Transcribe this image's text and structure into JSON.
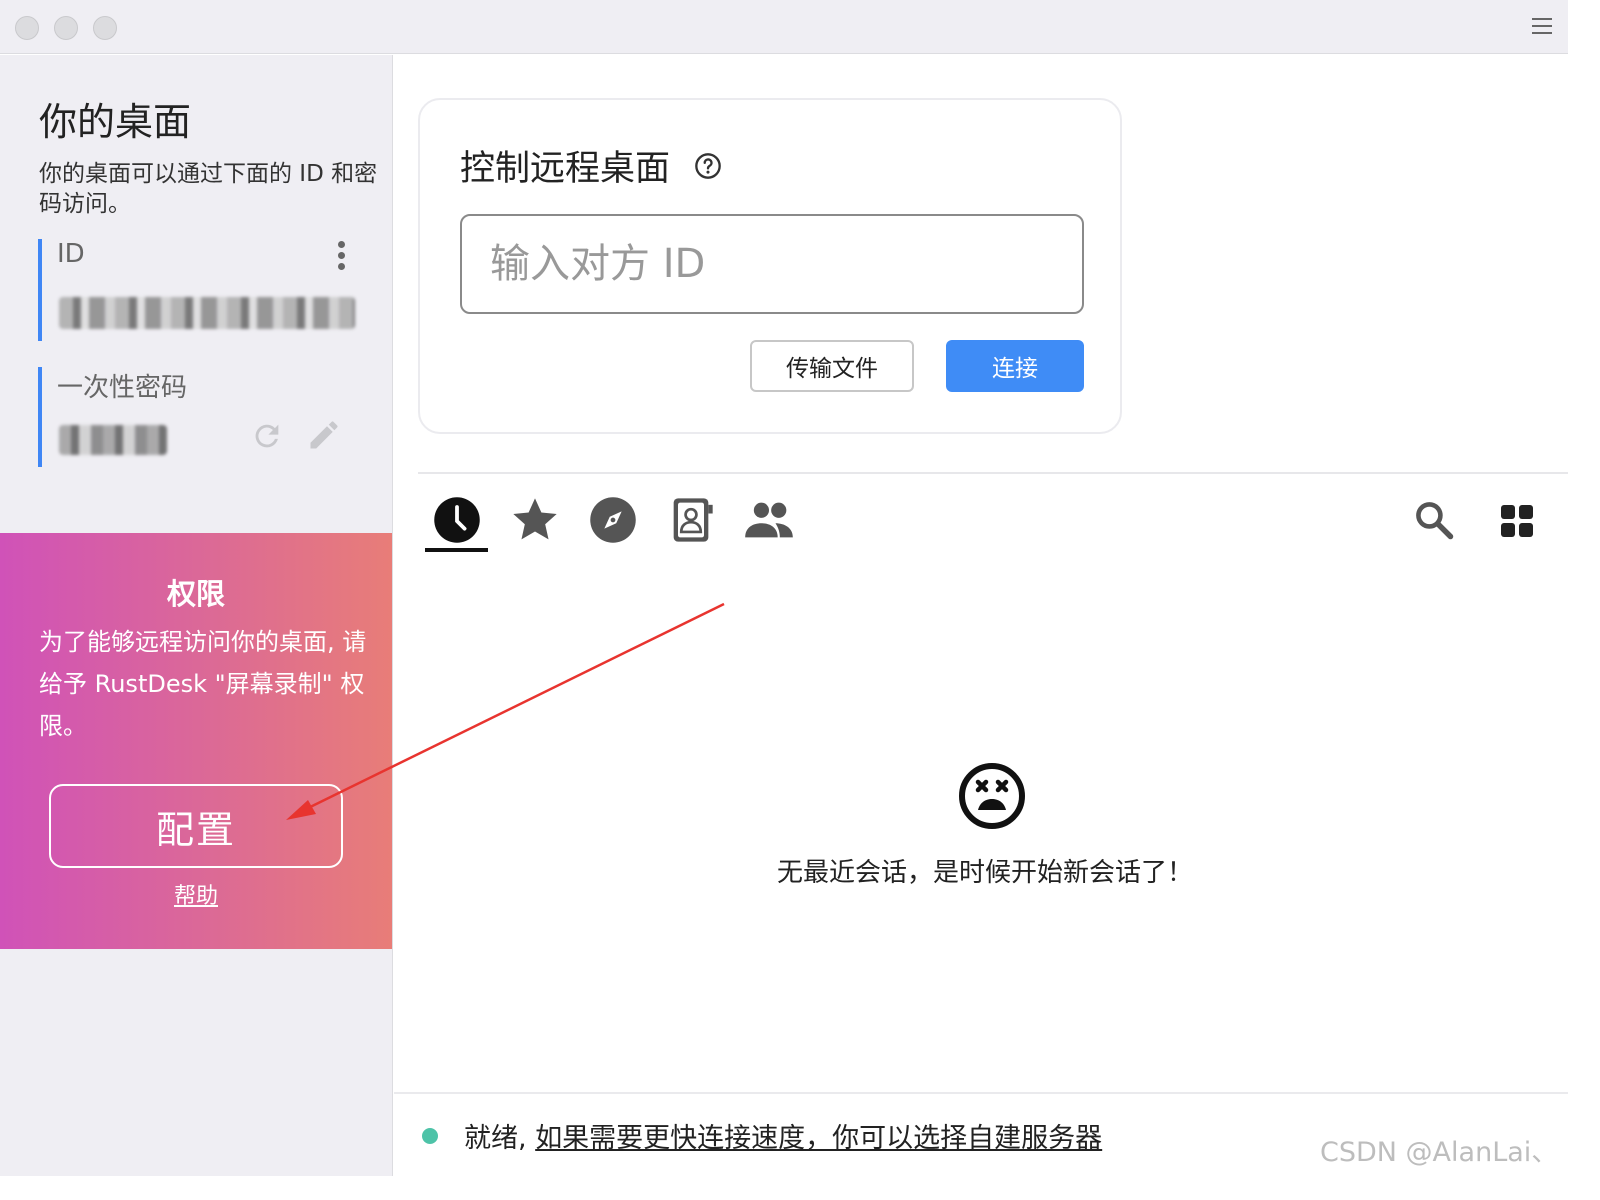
{
  "window": {
    "menu_icon": "hamburger-menu-icon"
  },
  "left": {
    "title": "你的桌面",
    "description": "你的桌面可以通过下面的 ID 和密码访问。",
    "id_label": "ID",
    "password_label": "一次性密码"
  },
  "permission": {
    "title": "权限",
    "text": "为了能够远程访问你的桌面, 请给予 RustDesk \"屏幕录制\" 权限。",
    "button_label": "配置",
    "help_link": "帮助",
    "gradient_start": "#d052b8",
    "gradient_end": "#e87d78"
  },
  "connect": {
    "title": "控制远程桌面",
    "input_placeholder": "输入对方 ID",
    "transfer_button": "传输文件",
    "connect_button": "连接",
    "accent": "#3f8cf6"
  },
  "tabs": [
    {
      "name": "recent",
      "icon": "clock-icon",
      "active": true
    },
    {
      "name": "favorites",
      "icon": "star-icon"
    },
    {
      "name": "discovered",
      "icon": "compass-icon"
    },
    {
      "name": "address-book",
      "icon": "contacts-icon"
    },
    {
      "name": "group",
      "icon": "people-icon"
    }
  ],
  "empty_state": {
    "icon": "sad-face-icon",
    "text": "无最近会话，是时候开始新会话了！"
  },
  "status": {
    "ready": "就绪,",
    "link": "如果需要更快连接速度，你可以选择自建服务器",
    "dot_color": "#4ec3a8"
  },
  "watermark": "CSDN @AlanLai、"
}
